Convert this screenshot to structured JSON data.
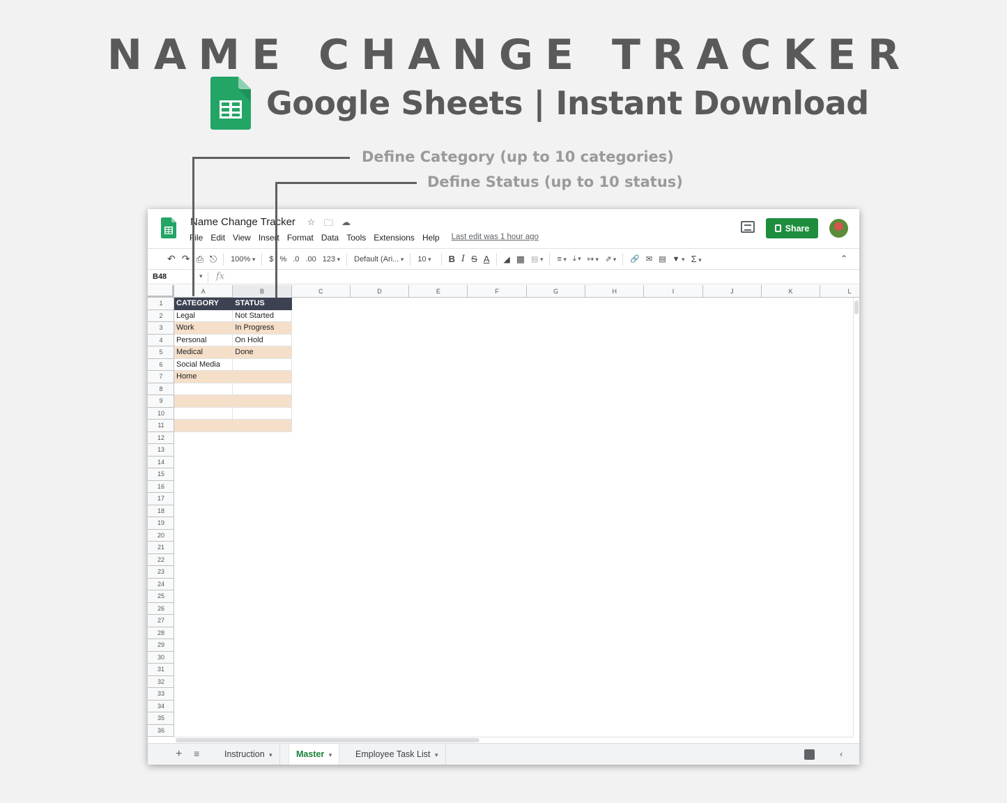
{
  "banner": {
    "title": "NAME CHANGE TRACKER",
    "subtitle": "Google Sheets | Instant Download"
  },
  "callouts": {
    "category": "Define Category (up to 10 categories)",
    "status": "Define Status (up to 10 status)"
  },
  "colors": {
    "header_dark": "#3c4251",
    "band": "#f5dfc9",
    "share_green": "#1e8e3e",
    "sheets_green": "#23a566"
  },
  "app": {
    "doc_title": "Name Change Tracker",
    "title_icons": [
      "star-icon",
      "folder-move-icon",
      "cloud-status-icon"
    ],
    "menu": [
      "File",
      "Edit",
      "View",
      "Insert",
      "Format",
      "Data",
      "Tools",
      "Extensions",
      "Help"
    ],
    "last_edit": "Last edit was 1 hour ago",
    "share_label": "Share"
  },
  "toolbar": {
    "zoom": "100%",
    "currency": "$",
    "percent": "%",
    "decimal_decrease": ".0",
    "decimal_increase": ".00",
    "more_formats": "123",
    "font": "Default (Ari...",
    "font_size": "10",
    "bold": "B",
    "italic": "I",
    "strike": "S",
    "text_color": "A",
    "sum": "Σ"
  },
  "formula_bar": {
    "name_box": "B48",
    "fx": "fx"
  },
  "grid": {
    "columns": [
      "A",
      "B",
      "C",
      "D",
      "E",
      "F",
      "G",
      "H",
      "I",
      "J",
      "K",
      "L"
    ],
    "row_count": 36,
    "header": [
      "CATEGORY",
      "STATUS"
    ],
    "categories": [
      "Legal",
      "Work",
      "Personal",
      "Medical",
      "Social Media",
      "Home"
    ],
    "statuses": [
      "Not Started",
      "In Progress",
      "On Hold",
      "Done"
    ],
    "table_rows": 10
  },
  "sheets": {
    "tabs": [
      "Instruction",
      "Master",
      "Employee Task List"
    ],
    "active": "Master"
  }
}
